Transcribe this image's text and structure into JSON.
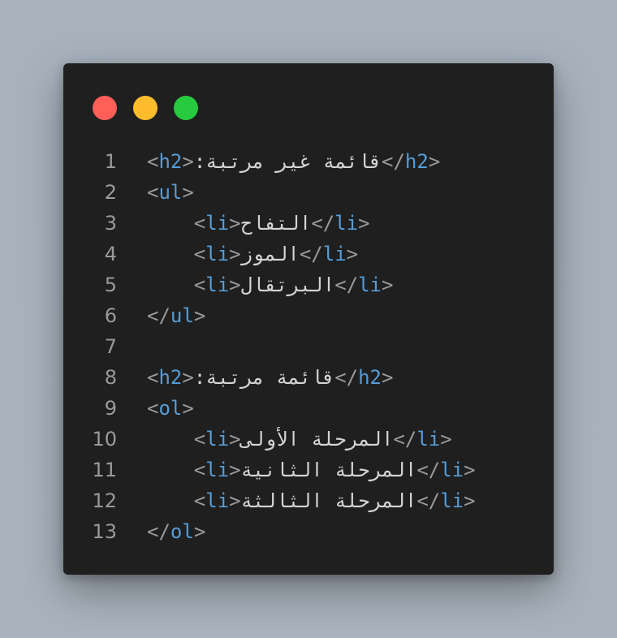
{
  "colors": {
    "background": "#a9b3bd",
    "window": "#1f1f1f",
    "line_number": "#9a9a9a",
    "punctuation": "#9a9a9a",
    "tag": "#569cd6",
    "text": "#d4d4d4",
    "dot_close": "#ff5f56",
    "dot_minimize": "#ffbd2e",
    "dot_maximize": "#27c93f"
  },
  "window_controls": [
    "close",
    "minimize",
    "maximize"
  ],
  "lines": [
    {
      "num": "1",
      "indent": "",
      "open": "h2",
      "text": "قائمة غير مرتبة:",
      "close": "h2"
    },
    {
      "num": "2",
      "indent": "",
      "open": "ul",
      "text": "",
      "close": ""
    },
    {
      "num": "3",
      "indent": "    ",
      "open": "li",
      "text": "التفاح",
      "close": "li"
    },
    {
      "num": "4",
      "indent": "    ",
      "open": "li",
      "text": "الموز",
      "close": "li"
    },
    {
      "num": "5",
      "indent": "    ",
      "open": "li",
      "text": "البرتقال",
      "close": "li"
    },
    {
      "num": "6",
      "indent": "",
      "open": "",
      "text": "",
      "close": "ul"
    },
    {
      "num": "7",
      "indent": "",
      "open": "",
      "text": "",
      "close": ""
    },
    {
      "num": "8",
      "indent": "",
      "open": "h2",
      "text": "قائمة مرتبة:",
      "close": "h2"
    },
    {
      "num": "9",
      "indent": "",
      "open": "ol",
      "text": "",
      "close": ""
    },
    {
      "num": "10",
      "indent": "    ",
      "open": "li",
      "text": "المرحلة الأولى",
      "close": "li"
    },
    {
      "num": "11",
      "indent": "    ",
      "open": "li",
      "text": "المرحلة الثانية",
      "close": "li"
    },
    {
      "num": "12",
      "indent": "    ",
      "open": "li",
      "text": "المرحلة الثالثة",
      "close": "li"
    },
    {
      "num": "13",
      "indent": "",
      "open": "",
      "text": "",
      "close": "ol"
    }
  ]
}
